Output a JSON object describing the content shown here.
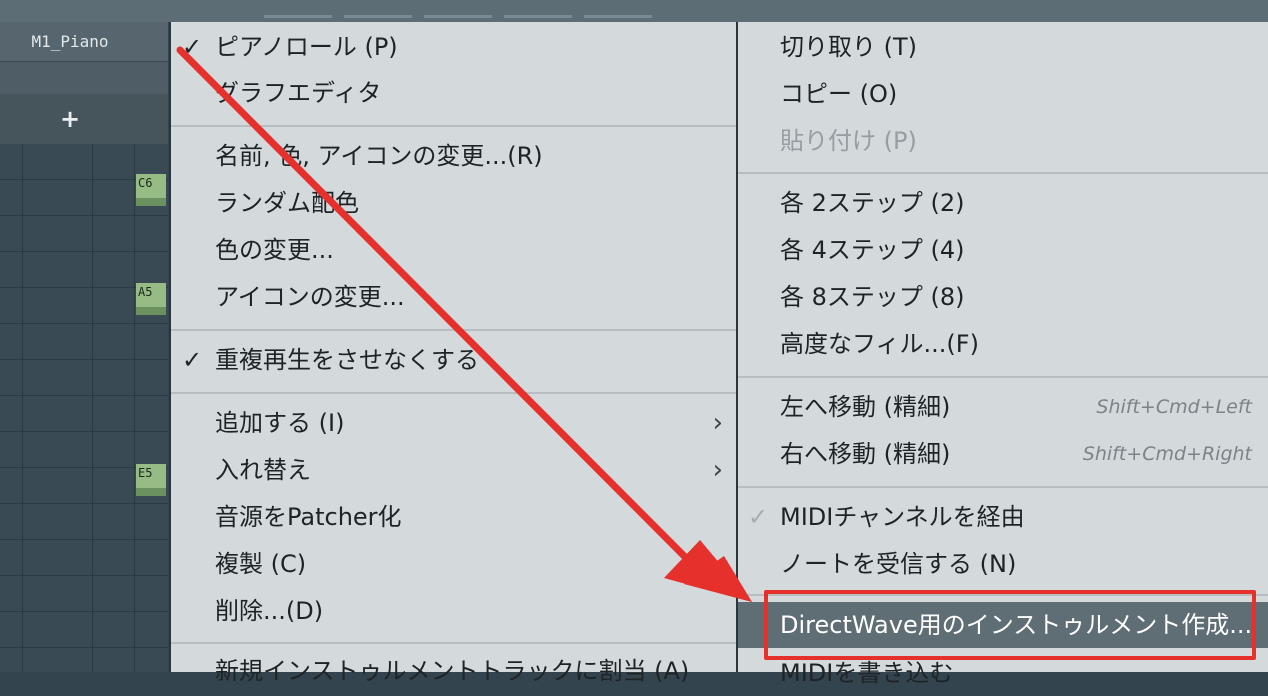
{
  "channel_rack": {
    "channel_name": "M1_Piano",
    "add_label": "+",
    "key_labels": [
      "C6",
      "A5",
      "E5"
    ]
  },
  "main_menu": {
    "items": [
      {
        "label": "ピアノロール (P)",
        "checked": true
      },
      {
        "label": "グラフエディタ"
      },
      {
        "label": "名前, 色, アイコンの変更...(R)"
      },
      {
        "label": "ランダム配色"
      },
      {
        "label": "色の変更..."
      },
      {
        "label": "アイコンの変更..."
      },
      {
        "label": "重複再生をさせなくする",
        "checked": true
      },
      {
        "label": "追加する (I)",
        "submenu": true
      },
      {
        "label": "入れ替え",
        "submenu": true
      },
      {
        "label": "音源をPatcher化"
      },
      {
        "label": "複製 (C)"
      },
      {
        "label": "削除...(D)"
      },
      {
        "label": "新規インストゥルメントトラックに割当 (A)"
      }
    ],
    "check_glyph": "✓",
    "submenu_glyph": "›"
  },
  "sub_menu": {
    "items": [
      {
        "label": "切り取り (T)"
      },
      {
        "label": "コピー (O)"
      },
      {
        "label": "貼り付け (P)",
        "disabled": true
      },
      {
        "label": "各 2ステップ (2)"
      },
      {
        "label": "各 4ステップ (4)"
      },
      {
        "label": "各 8ステップ (8)"
      },
      {
        "label": "高度なフィル...(F)"
      },
      {
        "label": "左へ移動 (精細)",
        "shortcut": "Shift+Cmd+Left"
      },
      {
        "label": "右へ移動 (精細)",
        "shortcut": "Shift+Cmd+Right"
      },
      {
        "label": "MIDIチャンネルを経由",
        "checked": true
      },
      {
        "label": "ノートを受信する (N)",
        "submenu": true
      },
      {
        "label": "DirectWave用のインストゥルメント作成...",
        "highlighted": true
      },
      {
        "label": "MIDIを書き込む"
      }
    ]
  },
  "colors": {
    "menu_bg": "#d4d9dc",
    "highlight_bg": "#5f6d75",
    "annotation_red": "#e5302c"
  }
}
